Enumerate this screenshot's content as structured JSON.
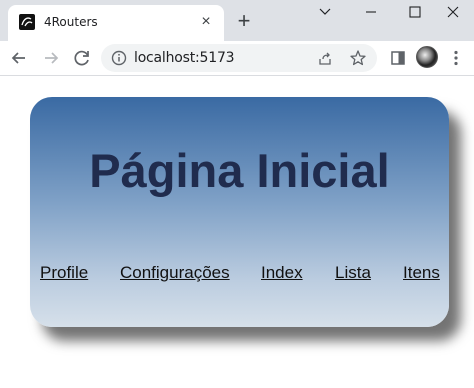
{
  "browser": {
    "tab_title": "4Routers",
    "url": "localhost:5173",
    "icons": {
      "favicon": "app-logo-icon",
      "close": "close-icon",
      "new_tab": "plus-icon",
      "back": "arrow-left-icon",
      "forward": "arrow-right-icon",
      "reload": "reload-icon",
      "site_info": "info-icon",
      "share": "share-icon",
      "bookmark": "star-icon",
      "side_panel": "side-panel-icon",
      "profile": "avatar",
      "menu": "kebab-menu-icon"
    }
  },
  "page": {
    "title": "Página Inicial",
    "nav_links": [
      "Profile",
      "Configurações",
      "Index",
      "Lista",
      "Itens"
    ]
  },
  "colors": {
    "title_text": "#202c4e",
    "card_top": "#3a6aa3",
    "card_bottom": "#d6e0ea",
    "tabbar_bg": "#dee1e6"
  }
}
